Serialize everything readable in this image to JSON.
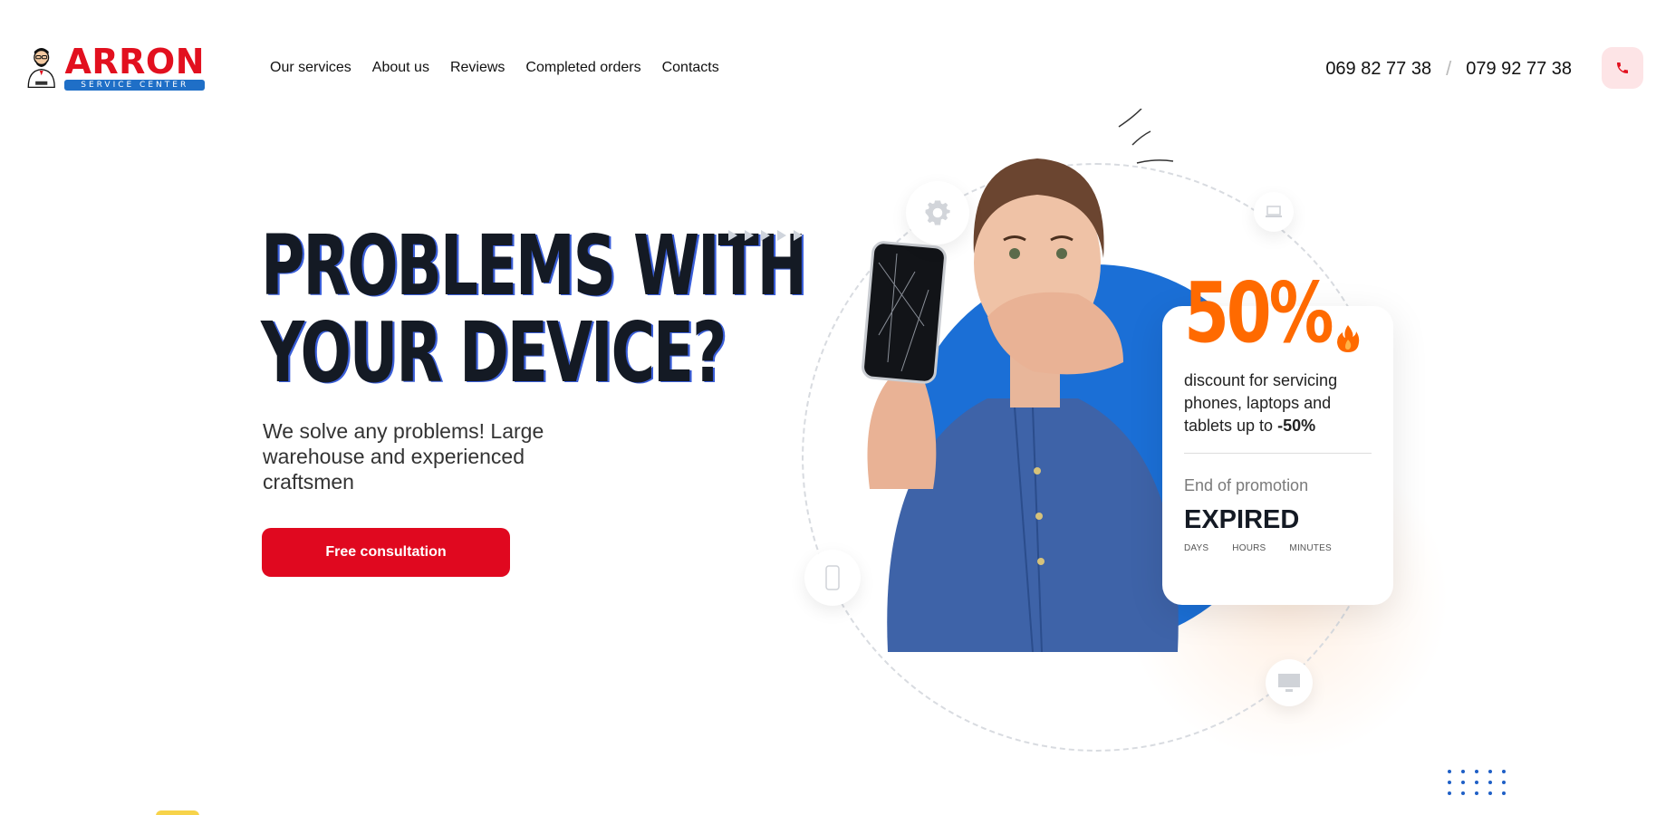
{
  "brand": {
    "name": "ARRON",
    "tagline": "SERVICE CENTER",
    "accent": "#e2101f",
    "secondary": "#1f6fc7"
  },
  "nav": {
    "items": [
      {
        "label": "Our services"
      },
      {
        "label": "About us"
      },
      {
        "label": "Reviews"
      },
      {
        "label": "Completed orders"
      },
      {
        "label": "Contacts"
      }
    ]
  },
  "contact": {
    "phone_1": "069 82 77 38",
    "separator": "/",
    "phone_2": "079 92 77 38",
    "call_icon": "phone-icon"
  },
  "hero": {
    "headline_line_1": "PROBLEMS WITH",
    "headline_line_2": "YOUR DEVICE?",
    "subtitle": "We solve any problems! Large warehouse and experienced craftsmen",
    "cta_label": "Free consultation",
    "cta_color": "#e0081f"
  },
  "promo": {
    "percent": "50%",
    "description_prefix": "discount for servicing phones, laptops and tablets up to ",
    "description_bold": "-50%",
    "end_label": "End of promotion",
    "status": "EXPIRED",
    "units": [
      "DAYS",
      "HOURS",
      "MINUTES"
    ],
    "accent": "#ff6a00"
  },
  "illustration": {
    "orbit_icons": [
      "gear-icon",
      "laptop-icon",
      "smartphone-icon",
      "monitor-icon"
    ]
  }
}
